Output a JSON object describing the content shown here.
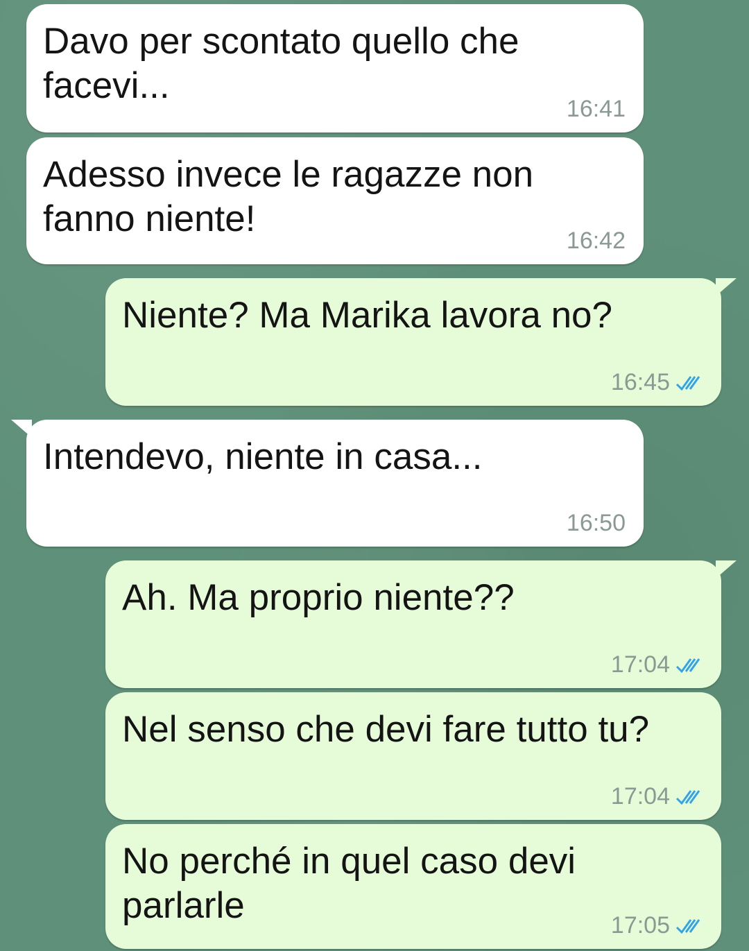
{
  "messages": [
    {
      "direction": "in",
      "text": "Davo per scontato quello che facevi...",
      "time": "16:41"
    },
    {
      "direction": "in",
      "text": "Adesso invece le ragazze non fanno niente!",
      "time": "16:42"
    },
    {
      "direction": "out",
      "text": "Niente? Ma Marika lavora no?",
      "time": "16:45",
      "status": "read"
    },
    {
      "direction": "in",
      "text": "Intendevo, niente in casa...",
      "time": "16:50"
    },
    {
      "direction": "out",
      "text": "Ah. Ma proprio niente??",
      "time": "17:04",
      "status": "read"
    },
    {
      "direction": "out",
      "text": "Nel senso che devi fare tutto tu?",
      "time": "17:04",
      "status": "read"
    },
    {
      "direction": "out",
      "text": "No perché in quel caso devi parlarle",
      "time": "17:05",
      "status": "read"
    }
  ],
  "colors": {
    "incoming_bubble": "#ffffff",
    "outgoing_bubble": "#e6fcd9",
    "read_ticks": "#34a3e6",
    "timestamp": "#8a9a93",
    "chat_background": "#5f9079"
  },
  "icons": {
    "read_receipt": "double-check-icon"
  }
}
